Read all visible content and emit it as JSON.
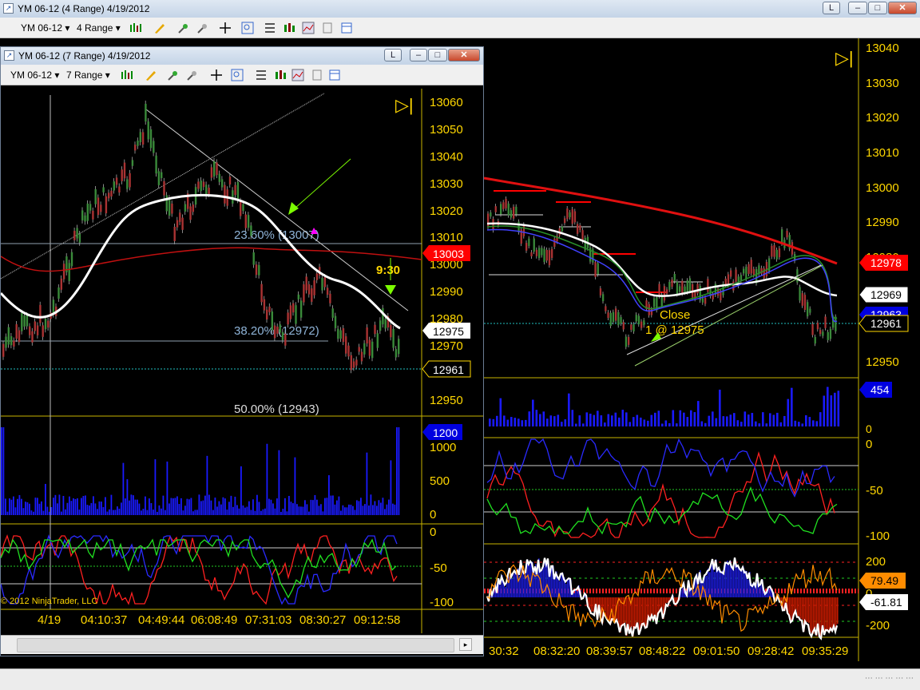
{
  "back_window": {
    "title": "YM 06-12 (4 Range)  4/19/2012",
    "instrument": "YM 06-12",
    "bar_type": "4 Range",
    "play_icon_text": "▷|",
    "price_axis": [
      "13040",
      "13030",
      "13020",
      "13010",
      "13000",
      "12990",
      "12980",
      "12970",
      "12960",
      "12950"
    ],
    "price_markers": {
      "sma_red": "12978",
      "sma_white": "12969",
      "hidden": "12963",
      "last": "12961"
    },
    "annotation_close": "Close",
    "annotation_fill": "1 @ 12975",
    "volume_axis": [
      "0"
    ],
    "volume_marker": "454",
    "stoch_axis": [
      "0",
      "-50",
      "-100"
    ],
    "cci_axis": [
      "200",
      "0",
      "-200"
    ],
    "cci_markers": {
      "a": "79.49",
      "b": "-61.81"
    },
    "time_axis": [
      "30:32",
      "08:32:20",
      "08:39:57",
      "08:48:22",
      "09:01:50",
      "09:28:42",
      "09:35:29"
    ]
  },
  "front_window": {
    "title": "YM 06-12 (7 Range)  4/19/2012",
    "instrument": "YM 06-12",
    "bar_type": "7 Range",
    "play_icon_text": "▷|",
    "price_axis": [
      "13060",
      "13050",
      "13040",
      "13030",
      "13020",
      "13010",
      "13000",
      "12990",
      "12980",
      "12970",
      "12960",
      "12950"
    ],
    "price_markers": {
      "sma_red": "13003",
      "last_close": "12975",
      "last": "12961"
    },
    "fib_labels": [
      "23.60% (13007)",
      "38.20% (12972)",
      "50.00% (12943)"
    ],
    "time_label_930": "9:30",
    "volume_axis": [
      "1000",
      "500",
      "0"
    ],
    "volume_marker": "1200",
    "stoch_axis": [
      "0",
      "-50",
      "-100"
    ],
    "copyright": "© 2012 NinjaTrader, LLC",
    "time_axis": [
      "4/19",
      "04:10:37",
      "04:49:44",
      "06:08:49",
      "07:31:03",
      "08:30:27",
      "09:12:58"
    ]
  },
  "colors": {
    "axis_text": "#ffd700",
    "sma_red": "#e01010",
    "sma_white": "#ffffff",
    "volume": "#1a1aff",
    "stoch_red": "#ff2020",
    "stoch_blue": "#2a2aff",
    "stoch_green": "#20e020",
    "cci_fill_red": "#c21a00",
    "cci_fill_blue": "#1a1ad0",
    "cci_orange": "#ff8c00",
    "arrow_green": "#7cfc00",
    "arrow_magenta": "#ff00ff",
    "marker_red_bg": "#ff0000",
    "marker_blue_bg": "#0000e0",
    "marker_orange_bg": "#ff8c00"
  }
}
